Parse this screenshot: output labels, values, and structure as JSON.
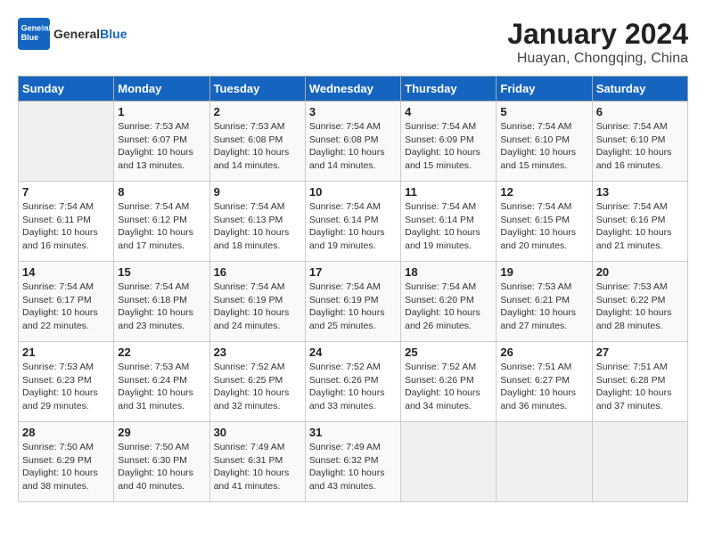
{
  "header": {
    "logo_line1": "General",
    "logo_line2": "Blue",
    "month_year": "January 2024",
    "location": "Huayan, Chongqing, China"
  },
  "days_of_week": [
    "Sunday",
    "Monday",
    "Tuesday",
    "Wednesday",
    "Thursday",
    "Friday",
    "Saturday"
  ],
  "weeks": [
    [
      {
        "day": "",
        "info": ""
      },
      {
        "day": "1",
        "info": "Sunrise: 7:53 AM\nSunset: 6:07 PM\nDaylight: 10 hours\nand 13 minutes."
      },
      {
        "day": "2",
        "info": "Sunrise: 7:53 AM\nSunset: 6:08 PM\nDaylight: 10 hours\nand 14 minutes."
      },
      {
        "day": "3",
        "info": "Sunrise: 7:54 AM\nSunset: 6:08 PM\nDaylight: 10 hours\nand 14 minutes."
      },
      {
        "day": "4",
        "info": "Sunrise: 7:54 AM\nSunset: 6:09 PM\nDaylight: 10 hours\nand 15 minutes."
      },
      {
        "day": "5",
        "info": "Sunrise: 7:54 AM\nSunset: 6:10 PM\nDaylight: 10 hours\nand 15 minutes."
      },
      {
        "day": "6",
        "info": "Sunrise: 7:54 AM\nSunset: 6:10 PM\nDaylight: 10 hours\nand 16 minutes."
      }
    ],
    [
      {
        "day": "7",
        "info": "Sunrise: 7:54 AM\nSunset: 6:11 PM\nDaylight: 10 hours\nand 16 minutes."
      },
      {
        "day": "8",
        "info": "Sunrise: 7:54 AM\nSunset: 6:12 PM\nDaylight: 10 hours\nand 17 minutes."
      },
      {
        "day": "9",
        "info": "Sunrise: 7:54 AM\nSunset: 6:13 PM\nDaylight: 10 hours\nand 18 minutes."
      },
      {
        "day": "10",
        "info": "Sunrise: 7:54 AM\nSunset: 6:14 PM\nDaylight: 10 hours\nand 19 minutes."
      },
      {
        "day": "11",
        "info": "Sunrise: 7:54 AM\nSunset: 6:14 PM\nDaylight: 10 hours\nand 19 minutes."
      },
      {
        "day": "12",
        "info": "Sunrise: 7:54 AM\nSunset: 6:15 PM\nDaylight: 10 hours\nand 20 minutes."
      },
      {
        "day": "13",
        "info": "Sunrise: 7:54 AM\nSunset: 6:16 PM\nDaylight: 10 hours\nand 21 minutes."
      }
    ],
    [
      {
        "day": "14",
        "info": "Sunrise: 7:54 AM\nSunset: 6:17 PM\nDaylight: 10 hours\nand 22 minutes."
      },
      {
        "day": "15",
        "info": "Sunrise: 7:54 AM\nSunset: 6:18 PM\nDaylight: 10 hours\nand 23 minutes."
      },
      {
        "day": "16",
        "info": "Sunrise: 7:54 AM\nSunset: 6:19 PM\nDaylight: 10 hours\nand 24 minutes."
      },
      {
        "day": "17",
        "info": "Sunrise: 7:54 AM\nSunset: 6:19 PM\nDaylight: 10 hours\nand 25 minutes."
      },
      {
        "day": "18",
        "info": "Sunrise: 7:54 AM\nSunset: 6:20 PM\nDaylight: 10 hours\nand 26 minutes."
      },
      {
        "day": "19",
        "info": "Sunrise: 7:53 AM\nSunset: 6:21 PM\nDaylight: 10 hours\nand 27 minutes."
      },
      {
        "day": "20",
        "info": "Sunrise: 7:53 AM\nSunset: 6:22 PM\nDaylight: 10 hours\nand 28 minutes."
      }
    ],
    [
      {
        "day": "21",
        "info": "Sunrise: 7:53 AM\nSunset: 6:23 PM\nDaylight: 10 hours\nand 29 minutes."
      },
      {
        "day": "22",
        "info": "Sunrise: 7:53 AM\nSunset: 6:24 PM\nDaylight: 10 hours\nand 31 minutes."
      },
      {
        "day": "23",
        "info": "Sunrise: 7:52 AM\nSunset: 6:25 PM\nDaylight: 10 hours\nand 32 minutes."
      },
      {
        "day": "24",
        "info": "Sunrise: 7:52 AM\nSunset: 6:26 PM\nDaylight: 10 hours\nand 33 minutes."
      },
      {
        "day": "25",
        "info": "Sunrise: 7:52 AM\nSunset: 6:26 PM\nDaylight: 10 hours\nand 34 minutes."
      },
      {
        "day": "26",
        "info": "Sunrise: 7:51 AM\nSunset: 6:27 PM\nDaylight: 10 hours\nand 36 minutes."
      },
      {
        "day": "27",
        "info": "Sunrise: 7:51 AM\nSunset: 6:28 PM\nDaylight: 10 hours\nand 37 minutes."
      }
    ],
    [
      {
        "day": "28",
        "info": "Sunrise: 7:50 AM\nSunset: 6:29 PM\nDaylight: 10 hours\nand 38 minutes."
      },
      {
        "day": "29",
        "info": "Sunrise: 7:50 AM\nSunset: 6:30 PM\nDaylight: 10 hours\nand 40 minutes."
      },
      {
        "day": "30",
        "info": "Sunrise: 7:49 AM\nSunset: 6:31 PM\nDaylight: 10 hours\nand 41 minutes."
      },
      {
        "day": "31",
        "info": "Sunrise: 7:49 AM\nSunset: 6:32 PM\nDaylight: 10 hours\nand 43 minutes."
      },
      {
        "day": "",
        "info": ""
      },
      {
        "day": "",
        "info": ""
      },
      {
        "day": "",
        "info": ""
      }
    ]
  ]
}
